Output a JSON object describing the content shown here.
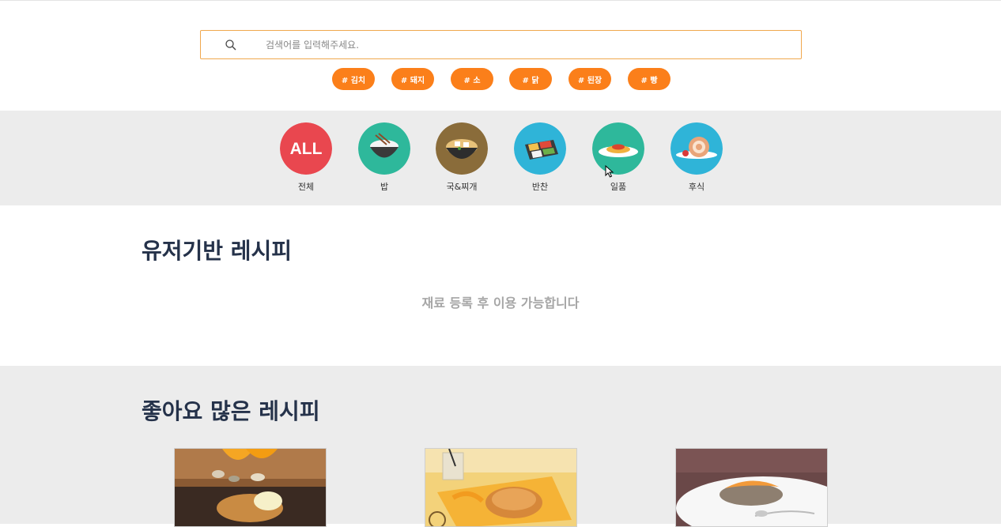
{
  "search": {
    "placeholder": "검색어를 입력해주세요."
  },
  "tags": [
    "# 김치",
    "# 돼지",
    "# 소",
    "# 닭",
    "# 된장",
    "# 빵"
  ],
  "categories": [
    {
      "label": "전체",
      "icon": "all-icon",
      "text": "ALL",
      "color": "#e9474f"
    },
    {
      "label": "밥",
      "icon": "rice-bowl-icon",
      "color": "#2eb89b"
    },
    {
      "label": "국&찌개",
      "icon": "soup-icon",
      "color": "#8a6c3a"
    },
    {
      "label": "반찬",
      "icon": "side-dish-icon",
      "color": "#2fb4d8"
    },
    {
      "label": "일품",
      "icon": "pasta-icon",
      "color": "#2eb89b"
    },
    {
      "label": "후식",
      "icon": "cake-roll-icon",
      "color": "#2fb4d8"
    }
  ],
  "user_recipes": {
    "title": "유저기반 레시피",
    "empty_message": "재료 등록 후 이용 가능합니다"
  },
  "liked_recipes": {
    "title": "좋아요 많은 레시피"
  },
  "colors": {
    "accent": "#fb7f1a",
    "search_border": "#f0a84e",
    "heading": "#25324a",
    "band": "#ececec"
  }
}
